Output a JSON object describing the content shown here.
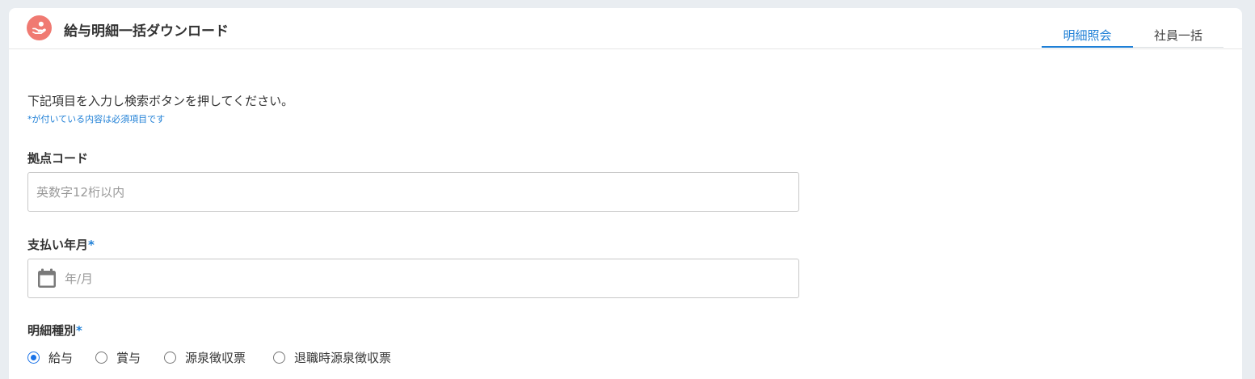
{
  "header": {
    "title": "給与明細一括ダウンロード",
    "logo_icon": "hand-coin-icon",
    "logo_color": "#f07a72"
  },
  "tabs": [
    {
      "label": "明細照会",
      "active": true
    },
    {
      "label": "社員一括",
      "active": false
    }
  ],
  "form": {
    "instruction": "下記項目を入力し検索ボタンを押してください。",
    "required_note": "*が付いている内容は必須項目です",
    "base_code": {
      "label": "拠点コード",
      "value": "",
      "placeholder": "英数字12桁以内"
    },
    "pay_month": {
      "label": "支払い年月",
      "required_mark": "*",
      "value": "",
      "placeholder": "年/月",
      "icon": "calendar-icon"
    },
    "statement_type": {
      "label": "明細種別",
      "required_mark": "*",
      "options": [
        {
          "label": "給与",
          "checked": true
        },
        {
          "label": "賞与",
          "checked": false
        },
        {
          "label": "源泉徴収票",
          "checked": false
        },
        {
          "label": "退職時源泉徴収票",
          "checked": false
        }
      ]
    }
  },
  "colors": {
    "accent": "#1e7fd6",
    "background": "#e9edf1",
    "card": "#ffffff"
  }
}
